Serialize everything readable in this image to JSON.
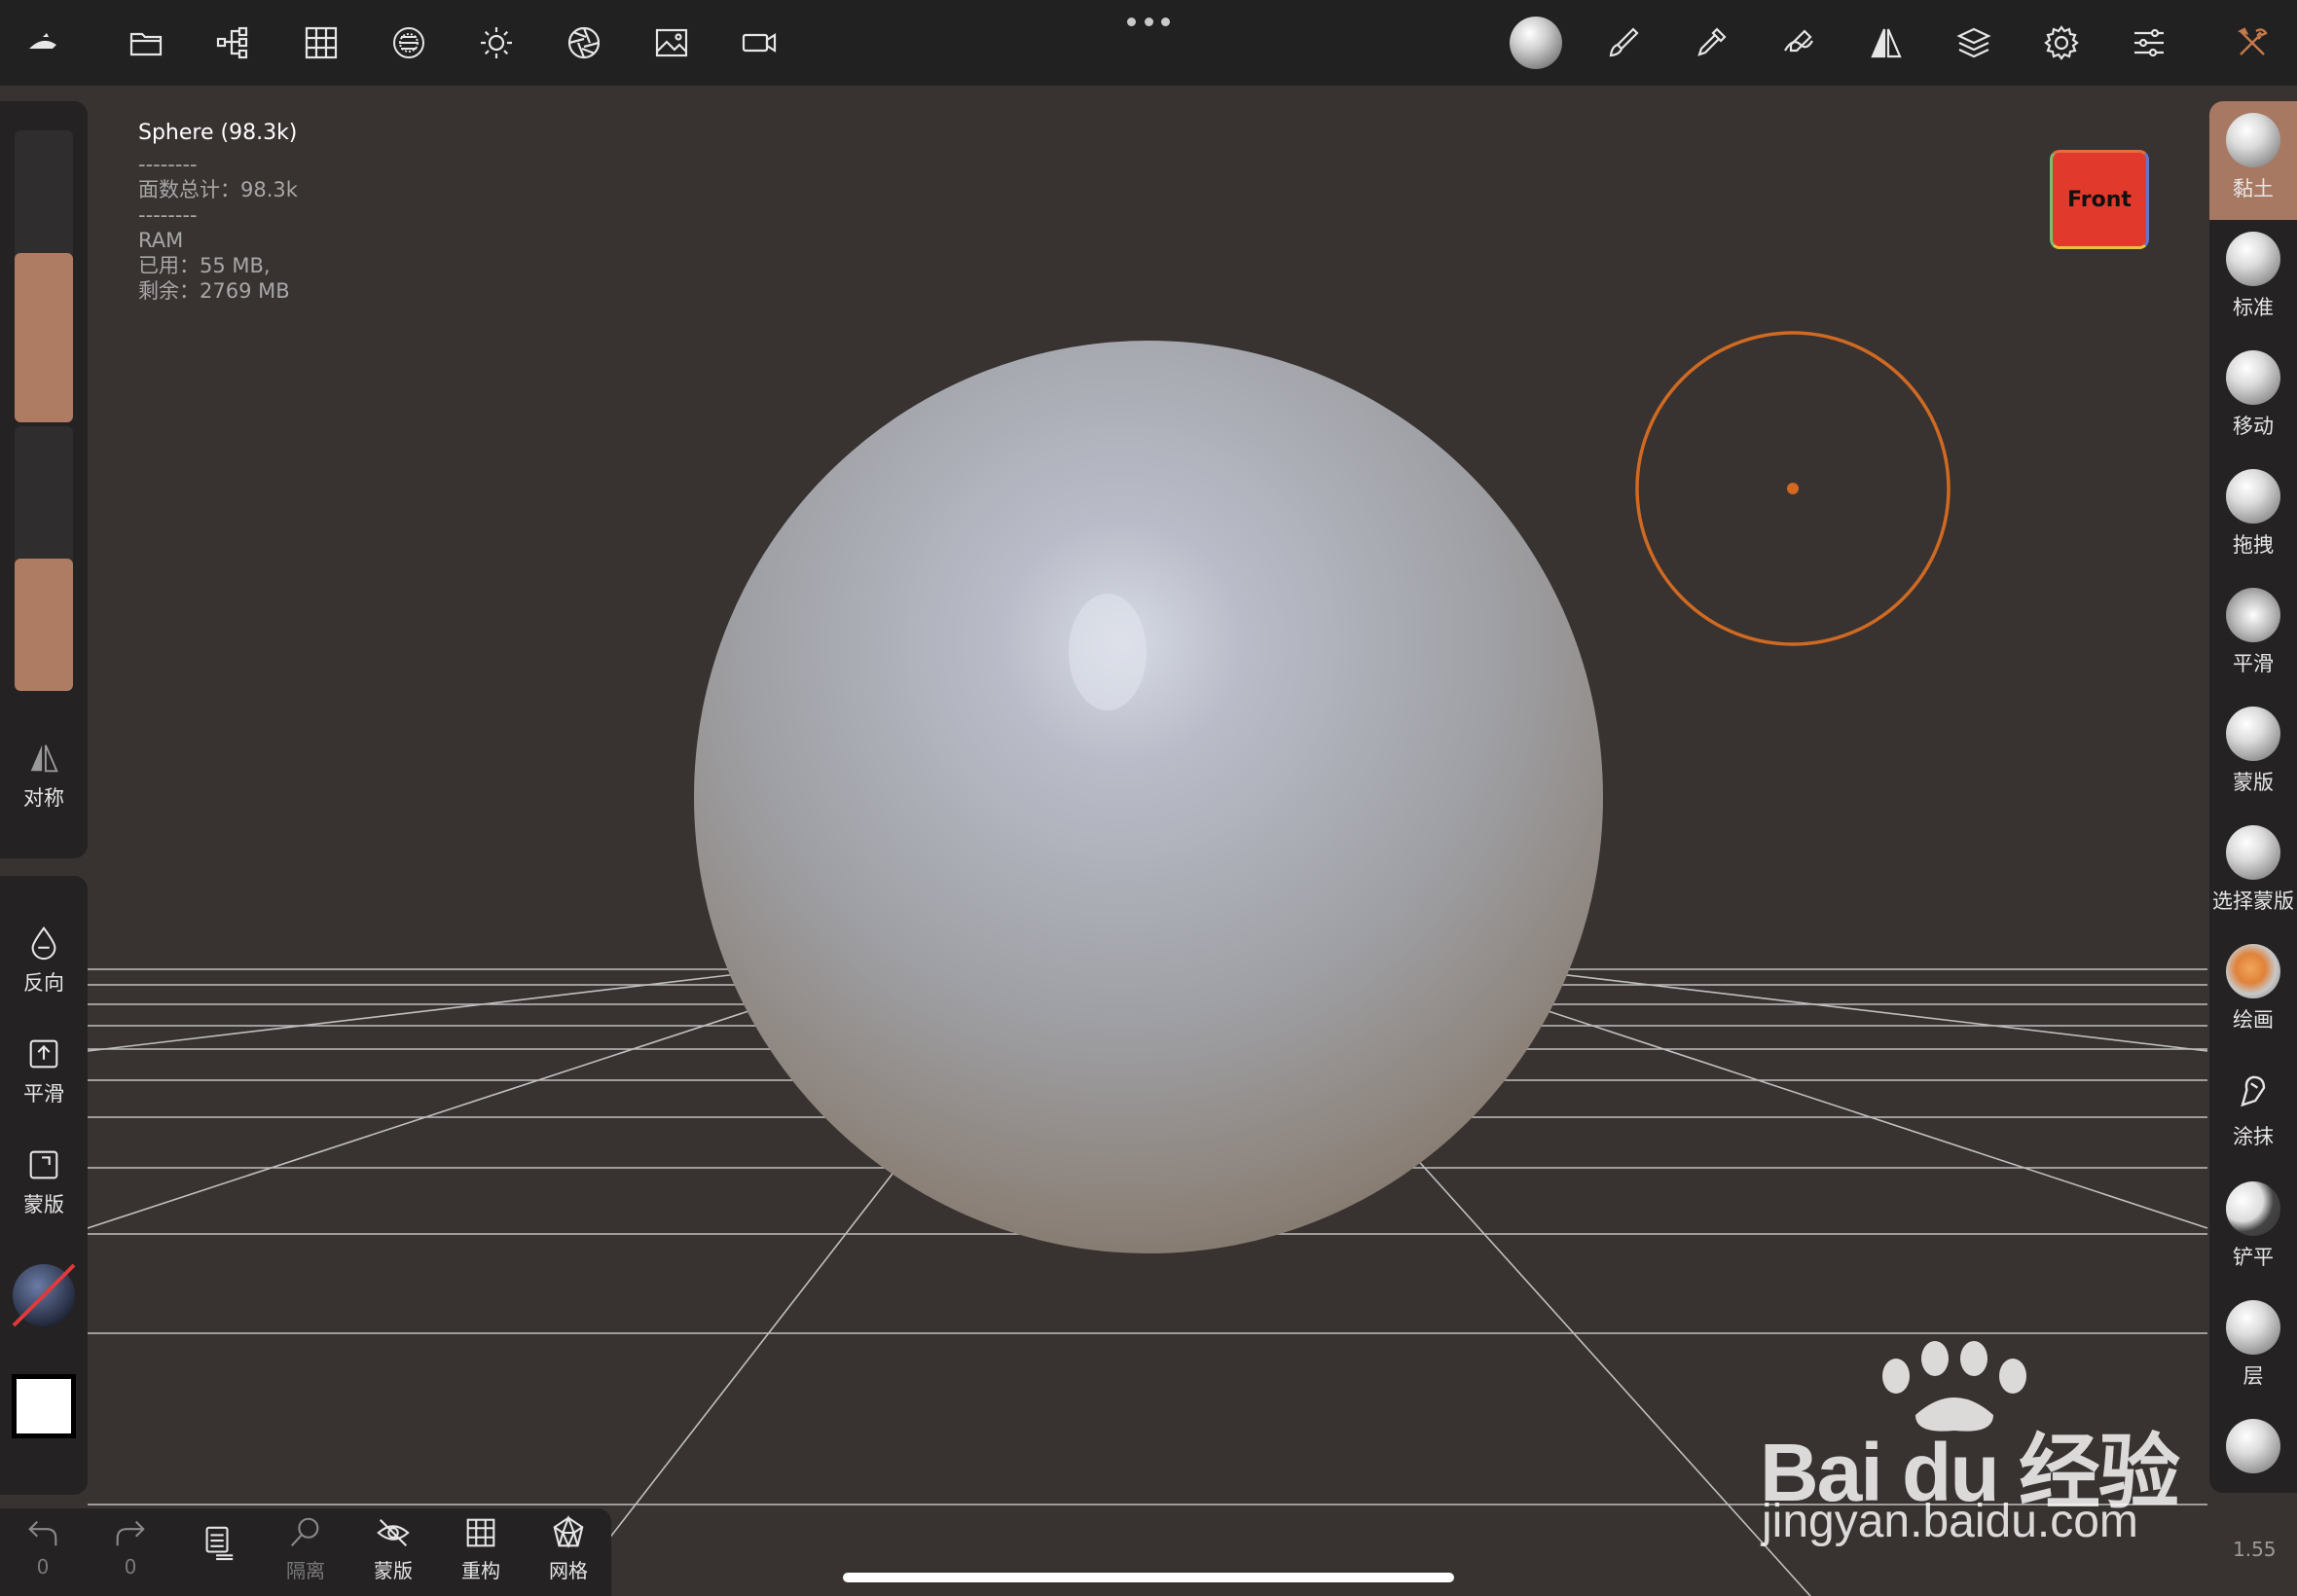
{
  "info": {
    "object_label": "Sphere (98.3k)",
    "sep1": "--------",
    "faces_label": "面数总计：",
    "faces_value": "98.3k",
    "sep2": "--------",
    "ram_title": "RAM",
    "used_label": "已用：",
    "used_value": "55 MB,",
    "free_label": "剩余：",
    "free_value": "2769 MB"
  },
  "view_cube": {
    "label": "Front"
  },
  "left_panel": {
    "radius_slider_level": 0.58,
    "intensity_slider_level": 0.5,
    "symmetry_label": "对称"
  },
  "left_tools": {
    "invert_label": "反向",
    "smooth_label": "平滑",
    "mask_label": "蒙版"
  },
  "brushes": [
    {
      "label": "黏土",
      "active": true
    },
    {
      "label": "标准",
      "active": false
    },
    {
      "label": "移动",
      "active": false
    },
    {
      "label": "拖拽",
      "active": false
    },
    {
      "label": "平滑",
      "active": false
    },
    {
      "label": "蒙版",
      "active": false
    },
    {
      "label": "选择蒙版",
      "active": false
    },
    {
      "label": "绘画",
      "active": false
    },
    {
      "label": "涂抹",
      "active": false
    },
    {
      "label": "铲平",
      "active": false
    },
    {
      "label": "层",
      "active": false
    }
  ],
  "bottom_bar": {
    "undo_count": "0",
    "redo_count": "0",
    "isolate_label": "隔离",
    "mask_label": "蒙版",
    "remesh_label": "重构",
    "mesh_label": "网格"
  },
  "version": "1.55",
  "watermark": {
    "brand": "Bai du 经验",
    "url": "jingyan.baidu.com"
  },
  "colors": {
    "accent": "#a77962",
    "brush_cursor": "#d06a22",
    "background": "#383331",
    "panel": "#242223"
  }
}
